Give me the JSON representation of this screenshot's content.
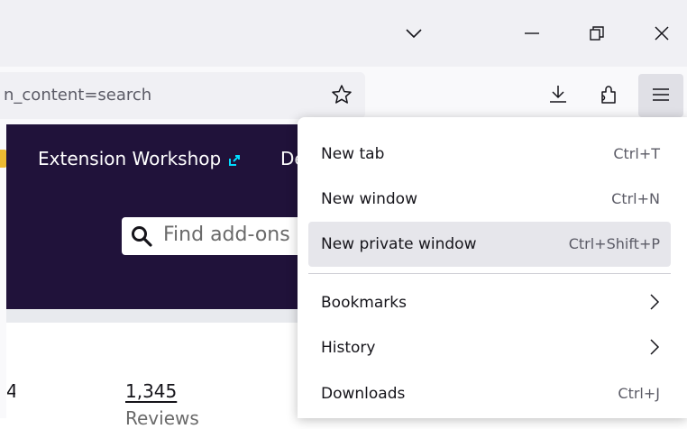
{
  "window": {
    "controls": [
      "chevron-down-icon",
      "minimize-icon",
      "restore-icon",
      "close-icon"
    ]
  },
  "toolbar": {
    "url_text": "n_content=search",
    "icons": [
      "star-icon",
      "download-icon",
      "extensions-icon",
      "hamburger-menu-icon"
    ]
  },
  "page": {
    "nav_links": [
      {
        "label": "Extension Workshop"
      },
      {
        "label": "De"
      }
    ],
    "search_placeholder": "Find add-ons",
    "stat_left_digit": "4",
    "stat_count": "1,345",
    "stat_label": "Reviews"
  },
  "menu": {
    "items": [
      {
        "label": "New tab",
        "shortcut": "Ctrl+T"
      },
      {
        "label": "New window",
        "shortcut": "Ctrl+N"
      },
      {
        "label": "New private window",
        "shortcut": "Ctrl+Shift+P",
        "highlighted": true
      },
      {
        "label": "Bookmarks",
        "chevron": true
      },
      {
        "label": "History",
        "chevron": true
      },
      {
        "label": "Downloads",
        "shortcut": "Ctrl+J"
      }
    ]
  },
  "colors": {
    "page_header_bg": "#20123a",
    "toolbar_bg": "#f9f9fb",
    "titlebar_bg": "#f0f0f4",
    "menu_highlight": "#e6e6eb",
    "external_link_icon": "#00ddff"
  }
}
